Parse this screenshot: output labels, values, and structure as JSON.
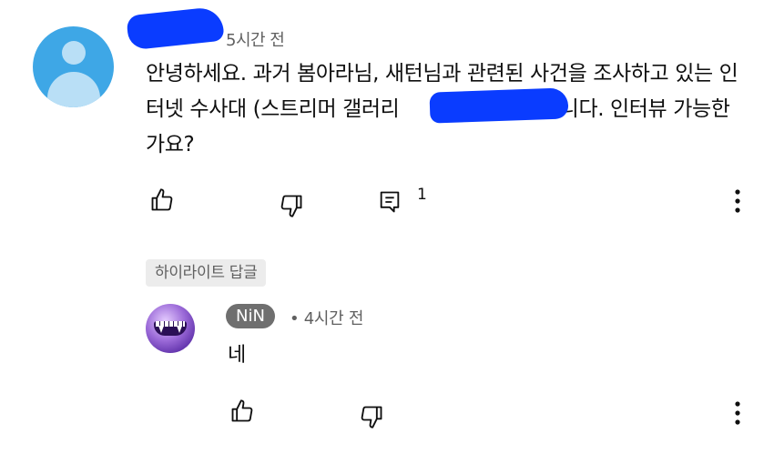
{
  "comment": {
    "time": "5시간 전",
    "text": "안녕하세요. 과거 봄아라님, 새턴님과 관련된 사건을 조사하고 있는 인터넷 수사대 (스트리머 갤러리",
    "text_after_redaction": ") 입니다. 인터뷰 가능한가요?",
    "avatar_icon": "default-person-avatar",
    "like_icon": "thumbs-up-icon",
    "dislike_icon": "thumbs-down-icon",
    "reply_icon": "comment-icon",
    "reply_count": "1",
    "more_icon": "more-vert-icon"
  },
  "highlight_chip": "하이라이트 답글",
  "reply": {
    "author": "NiN",
    "separator": "•",
    "time": "4시간 전",
    "text": "네",
    "like_icon": "thumbs-up-icon",
    "dislike_icon": "thumbs-down-icon",
    "more_icon": "more-vert-icon"
  },
  "colors": {
    "avatar_blue": "#3ea7e6",
    "redaction_blue": "#0a3cff",
    "secondary_text": "#606060",
    "name_pill": "#6f6f6f",
    "chip_bg": "#ececec"
  }
}
